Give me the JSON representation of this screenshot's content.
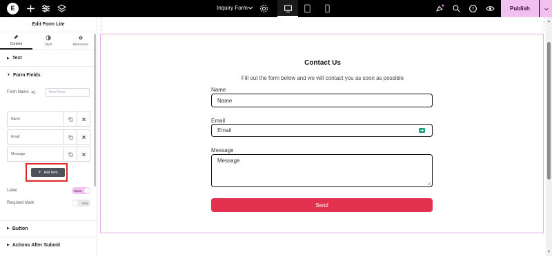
{
  "topbar": {
    "logo": "E",
    "page_title": "Inquiry Form",
    "publish_label": "Publish",
    "icons": [
      "add-icon",
      "settings-sliders-icon",
      "layers-icon",
      "page-settings-icon",
      "desktop-icon",
      "tablet-icon",
      "mobile-icon",
      "notifications-icon",
      "search-icon",
      "help-icon",
      "preview-eye-icon",
      "chevron-down-icon"
    ]
  },
  "panel": {
    "title": "Edit Form Lite",
    "tabs": [
      {
        "label": "Content",
        "icon": "pencil-icon",
        "active": true
      },
      {
        "label": "Style",
        "icon": "contrast-icon",
        "active": false
      },
      {
        "label": "Advanced",
        "icon": "gear-icon",
        "active": false
      }
    ],
    "sections": {
      "text": "Text",
      "form_fields": "Form Fields",
      "button": "Button",
      "actions": "Actions After Submit"
    },
    "form_name_label": "Form Name",
    "form_name_placeholder": "New Form",
    "items": [
      "Name",
      "Email",
      "Message"
    ],
    "add_item_label": "Add Item",
    "label_toggle": {
      "label": "Label",
      "state": "Show"
    },
    "required_toggle": {
      "label": "Required Mark",
      "state": "Hide"
    }
  },
  "form": {
    "title": "Contact Us",
    "subtitle": "Fill out the form below and we will contact you as soon as possible",
    "fields": [
      {
        "label": "Name",
        "placeholder": "Name"
      },
      {
        "label": "Email",
        "placeholder": "Email"
      },
      {
        "label": "Message",
        "placeholder": "Message"
      }
    ],
    "submit_label": "Send",
    "accent_color": "#e3324f",
    "frame_color": "#e9a8e6"
  }
}
